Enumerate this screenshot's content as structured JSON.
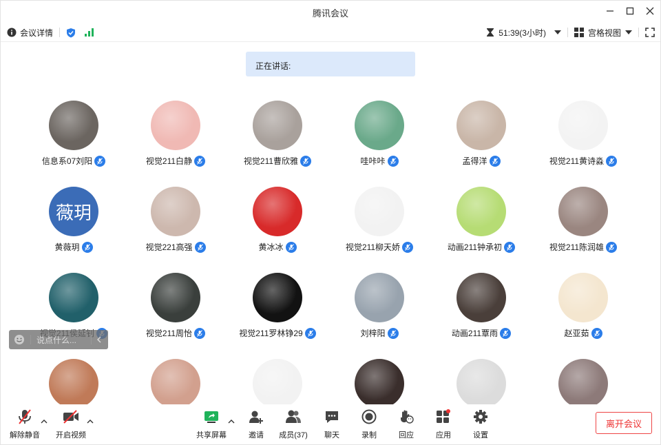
{
  "window": {
    "title": "腾讯会议"
  },
  "infobar": {
    "meeting_details": "会议详情",
    "timer": "51:39(3小时)",
    "view_mode": "宫格视图"
  },
  "speaking": {
    "label": "正在讲话:"
  },
  "participants": [
    {
      "name": "信息系07刘阳",
      "bg": "#6b6560"
    },
    {
      "name": "视觉211白静",
      "bg": "#f0b9b4"
    },
    {
      "name": "视觉211曹欣雅",
      "bg": "#a9a19c"
    },
    {
      "name": "哇咔咔",
      "bg": "#6aa98a"
    },
    {
      "name": "孟得洋",
      "bg": "#c9b6a8"
    },
    {
      "name": "视觉211黄诗淼",
      "bg": "#f3f3f3"
    },
    {
      "name": "黄薇玥",
      "bg": "#3b6cb7",
      "initials": "薇玥"
    },
    {
      "name": "视觉221高强",
      "bg": "#cdb8ae"
    },
    {
      "name": "黄冰冰",
      "bg": "#d82a2a"
    },
    {
      "name": "视觉211柳天娇",
      "bg": "#f2f2f2"
    },
    {
      "name": "动画211钟承初",
      "bg": "#b6dc74"
    },
    {
      "name": "视觉211陈润雄",
      "bg": "#9a8680"
    },
    {
      "name": "视觉211侯延钊",
      "bg": "#21606a"
    },
    {
      "name": "视觉211周怡",
      "bg": "#3a3f3c"
    },
    {
      "name": "视觉211罗林铮29",
      "bg": "#121212"
    },
    {
      "name": "刘梓阳",
      "bg": "#98a3ae"
    },
    {
      "name": "动画211覃雨",
      "bg": "#4a3f3a"
    },
    {
      "name": "赵亚茹",
      "bg": "#f4e6cf"
    },
    {
      "name": "",
      "bg": "#c07a58"
    },
    {
      "name": "",
      "bg": "#d2a08e"
    },
    {
      "name": "",
      "bg": "#f2f2f2"
    },
    {
      "name": "",
      "bg": "#3a2e2c"
    },
    {
      "name": "",
      "bg": "#dcdcdc"
    },
    {
      "name": "",
      "bg": "#8d7a79"
    }
  ],
  "floatchat": {
    "placeholder": "说点什么..."
  },
  "toolbar": {
    "unmute": "解除静音",
    "start_video": "开启视频",
    "share_screen": "共享屏幕",
    "invite": "邀请",
    "members": "成员(37)",
    "chat": "聊天",
    "record": "录制",
    "reactions": "回应",
    "apps": "应用",
    "settings": "设置",
    "leave": "离开会议"
  },
  "colors": {
    "accent": "#2b7de9",
    "danger": "#e33333",
    "speaking_bg": "#dce9fb"
  }
}
